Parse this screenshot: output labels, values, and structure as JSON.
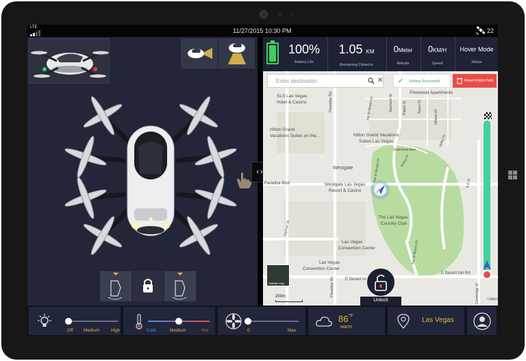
{
  "status_bar": {
    "network": "LTE",
    "datetime": "11/27/2015  10:30 PM",
    "satellite_count": "22"
  },
  "flight_stats": {
    "battery": {
      "value": "100%",
      "label": "Battery Life",
      "level": 1.0
    },
    "distance": {
      "value": "1.05",
      "unit": "KM",
      "label": "Remaining Distance"
    },
    "altitude": {
      "value": "0",
      "unit": "Meter",
      "label": "Altitude"
    },
    "speed": {
      "value": "0",
      "unit": "KM/H",
      "label": "Speed"
    },
    "status": {
      "value": "Hover Mode",
      "label": "Status"
    }
  },
  "map": {
    "search_placeholder": "Enter destination",
    "toast": "Setting Successful",
    "reset_button": "Reset Flight Path",
    "scale": "200m",
    "satellite_thumb_label": "Satellite Map",
    "unlock_label": "Unlock",
    "labels": {
      "pinewood": "Pinewood Apartments",
      "sls": "SLS Las Vegas",
      "sls2": "Hotel & Casino",
      "hilton1": "Hilton Grand",
      "hilton1b": "Vacations Suites on the...",
      "hilton2": "Hilton Grand Vacations",
      "hilton2b": "Suites Las Vegas",
      "oakmont": "Oakmont Ave",
      "westgate": "Westgate",
      "westgate_resort": "Westgate Las Vegas",
      "westgate_resort2": "Resort & Casino",
      "paradise_rd": "Paradise Rd",
      "paradise_rd2": "Paradise Rd",
      "country_club": "The Las Vegas",
      "country_club2": "Country Club",
      "convention1": "Las Vegas",
      "convention1b": "Convention Center",
      "convention2": "Las Vegas",
      "convention2b": "Convention Center",
      "e_desert": "E Desert Inn Rd",
      "e_desert2": "E Desert Inn Rd",
      "paradise_blvd": "Paradise Blvd",
      "joe_brown": "Joe W Brown Dr",
      "joe_brown2": "Joe W Brown Dr",
      "joe_brown3": "Joe W Brown Dr",
      "kishner": "Kishner Dr",
      "cambridge": "Cambridge St",
      "swenson": "Swenson St",
      "patten": "Patten St",
      "ottawa": "Ottawa Dr",
      "tepan": "Tepan St",
      "valley": "Valley Dr",
      "geary": "Geary Pl",
      "se_dr": "S E Dr",
      "lisbon": "Lisbon"
    }
  },
  "controls": {
    "light": {
      "ticks": [
        "Off",
        "Medium",
        "High"
      ],
      "level": 0.0
    },
    "temperature": {
      "ticks": [
        "Cold",
        "Medium",
        "Hot"
      ],
      "level": 0.5
    },
    "fan": {
      "ticks": [
        "0",
        "Max"
      ],
      "level": 0.0
    },
    "weather": {
      "temp": "86",
      "unit": "°F",
      "desc": "warm"
    },
    "location": {
      "city": "Las Vegas"
    }
  },
  "colors": {
    "accent": "#f0b23a",
    "battery": "#3fcf5a",
    "danger": "#ea4b48",
    "route": "#3ed49a",
    "panel": "#22263a"
  }
}
